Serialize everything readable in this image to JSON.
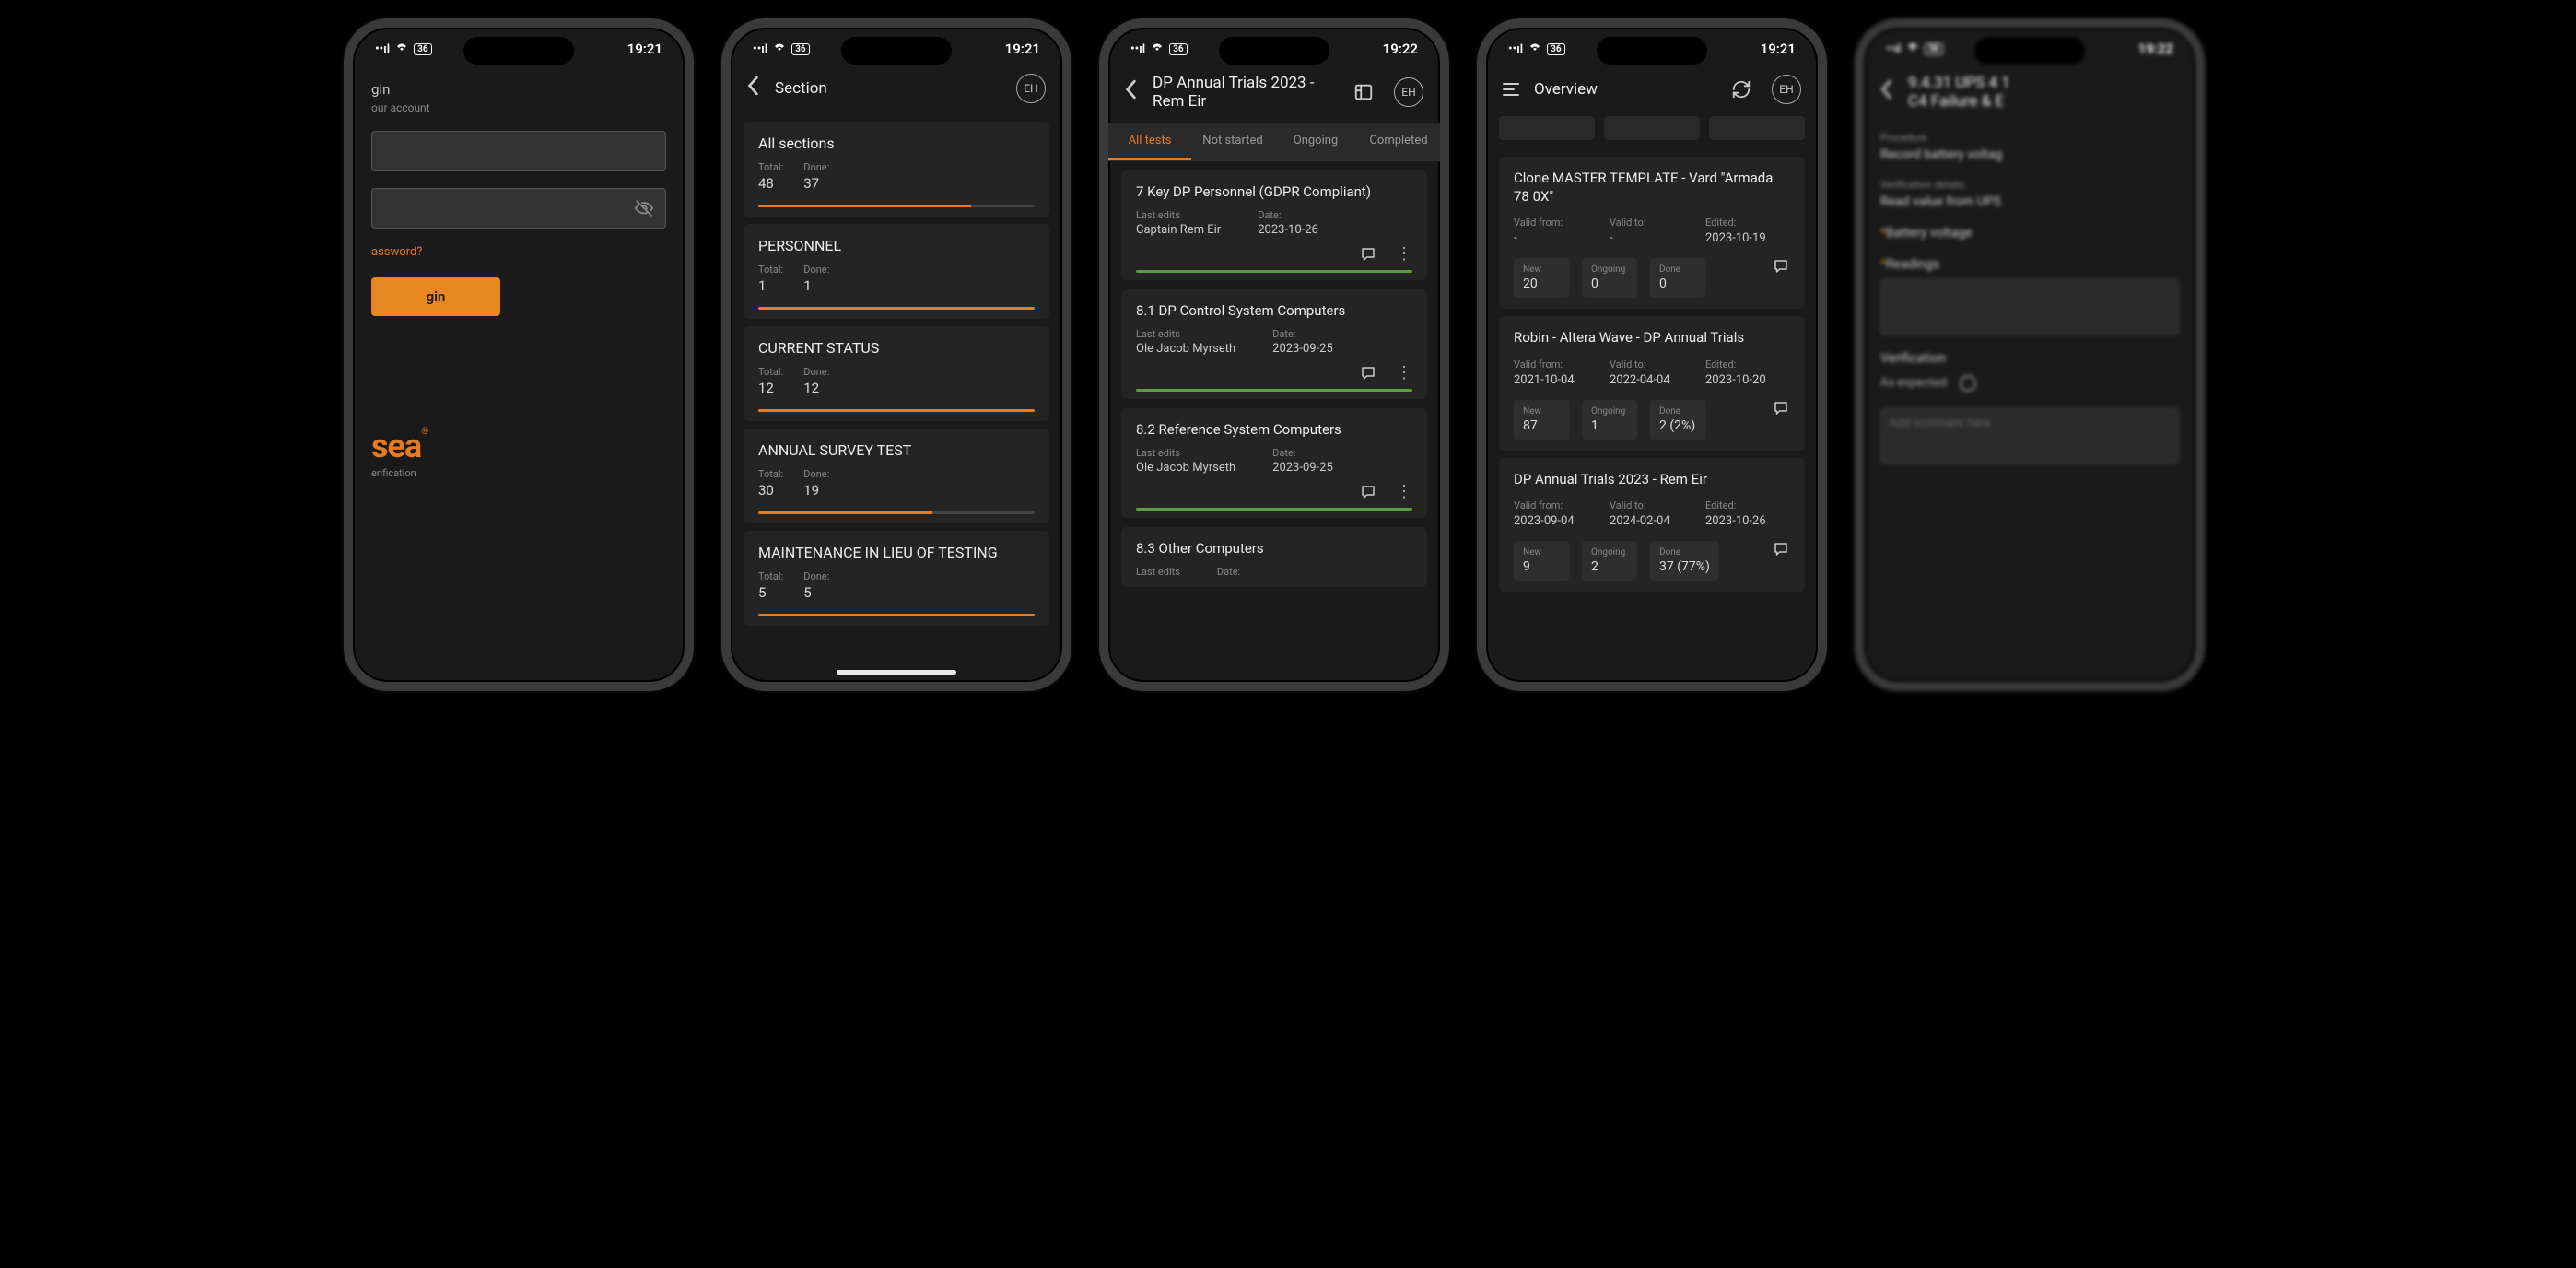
{
  "status": {
    "time_a": "19:21",
    "time_b": "19:22",
    "battery": "36"
  },
  "login": {
    "title": "gin",
    "subtitle": "our account",
    "forgot": "assword?",
    "button": "gin",
    "brand": "sea",
    "brand_sub": "erification"
  },
  "section": {
    "header": "Section",
    "avatar": "EH",
    "cards": [
      {
        "title": "All sections",
        "total_lbl": "Total:",
        "total": "48",
        "done_lbl": "Done:",
        "done": "37",
        "pct": 77
      },
      {
        "title": "PERSONNEL",
        "total_lbl": "Total:",
        "total": "1",
        "done_lbl": "Done:",
        "done": "1",
        "pct": 100
      },
      {
        "title": "CURRENT STATUS",
        "total_lbl": "Total:",
        "total": "12",
        "done_lbl": "Done:",
        "done": "12",
        "pct": 100
      },
      {
        "title": "ANNUAL SURVEY TEST",
        "total_lbl": "Total:",
        "total": "30",
        "done_lbl": "Done:",
        "done": "19",
        "pct": 63
      },
      {
        "title": "MAINTENANCE IN LIEU OF TESTING",
        "total_lbl": "Total:",
        "total": "5",
        "done_lbl": "Done:",
        "done": "5",
        "pct": 100
      }
    ]
  },
  "tests": {
    "header": "DP Annual Trials 2023 - Rem Eir",
    "avatar": "EH",
    "tabs": [
      "All tests",
      "Not started",
      "Ongoing",
      "Completed"
    ],
    "items": [
      {
        "title": "7 Key DP Personnel (GDPR Compliant)",
        "edits_lbl": "Last edits",
        "edits": "Captain Rem Eir",
        "date_lbl": "Date:",
        "date": "2023-10-26",
        "pct": 100
      },
      {
        "title": "8.1 DP Control System Computers",
        "edits_lbl": "Last edits",
        "edits": "Ole Jacob Myrseth",
        "date_lbl": "Date:",
        "date": "2023-09-25",
        "pct": 100
      },
      {
        "title": "8.2 Reference System Computers",
        "edits_lbl": "Last edits",
        "edits": "Ole Jacob Myrseth",
        "date_lbl": "Date:",
        "date": "2023-09-25",
        "pct": 100
      },
      {
        "title": "8.3 Other Computers",
        "edits_lbl": "Last edits",
        "edits": "",
        "date_lbl": "Date:",
        "date": "",
        "pct": 0
      }
    ]
  },
  "overview": {
    "header": "Overview",
    "avatar": "EH",
    "items": [
      {
        "title": "Clone MASTER TEMPLATE - Vard \"Armada 78 0X\"",
        "valid_from_lbl": "Valid from:",
        "valid_from": "-",
        "valid_to_lbl": "Valid to:",
        "valid_to": "-",
        "edited_lbl": "Edited:",
        "edited": "2023-10-19",
        "new_lbl": "New",
        "new": "20",
        "ongoing_lbl": "Ongoing",
        "ongoing": "0",
        "done_lbl": "Done",
        "done": "0"
      },
      {
        "title": "Robin - Altera Wave - DP Annual Trials",
        "valid_from_lbl": "Valid from:",
        "valid_from": "2021-10-04",
        "valid_to_lbl": "Valid to:",
        "valid_to": "2022-04-04",
        "edited_lbl": "Edited:",
        "edited": "2023-10-20",
        "new_lbl": "New",
        "new": "87",
        "ongoing_lbl": "Ongoing",
        "ongoing": "1",
        "done_lbl": "Done",
        "done": "2 (2%)"
      },
      {
        "title": "DP Annual Trials 2023 - Rem Eir",
        "valid_from_lbl": "Valid from:",
        "valid_from": "2023-09-04",
        "valid_to_lbl": "Valid to:",
        "valid_to": "2024-02-04",
        "edited_lbl": "Edited:",
        "edited": "2023-10-26",
        "new_lbl": "New",
        "new": "9",
        "ongoing_lbl": "Ongoing",
        "ongoing": "2",
        "done_lbl": "Done",
        "done": "37 (77%)"
      }
    ]
  },
  "detail": {
    "header": "9.4.31 UPS 4 1\nC4 Failure & E",
    "proc_lbl": "Procedure",
    "proc_val": "Record battery voltag",
    "verif_lbl": "Verification details:",
    "verif_val": "Read value from UPS ",
    "field1_lbl": "Battery voltage",
    "field2_lbl": "Readings",
    "verification_header": "Verification",
    "expected_lbl": "As expected:",
    "comment_placeholder": "Add comment here"
  }
}
